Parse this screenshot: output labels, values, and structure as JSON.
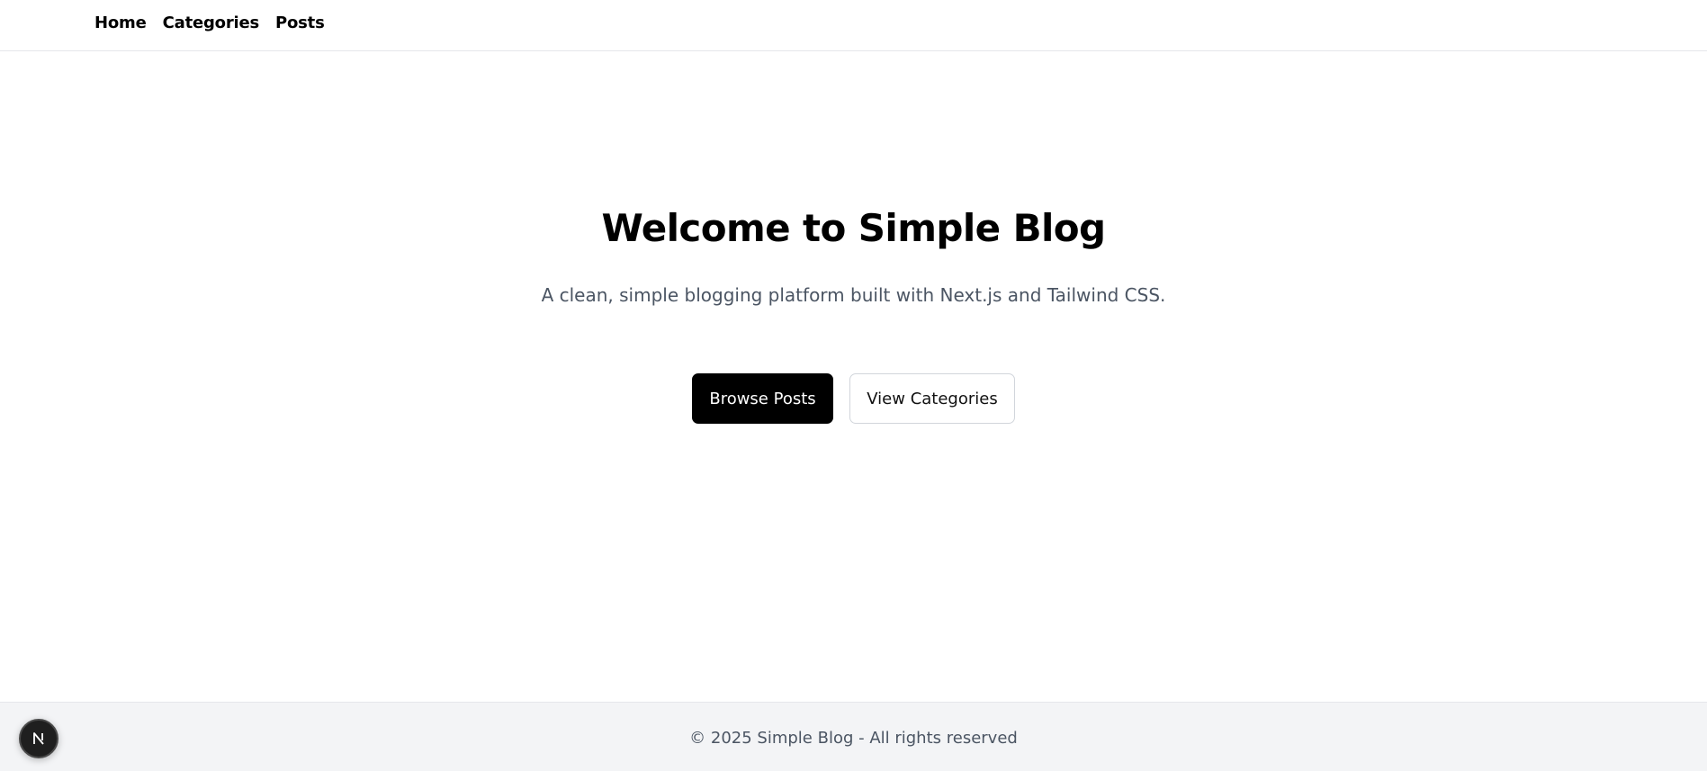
{
  "nav": {
    "links": [
      {
        "label": "Home"
      },
      {
        "label": "Categories"
      },
      {
        "label": "Posts"
      }
    ]
  },
  "hero": {
    "title": "Welcome to Simple Blog",
    "subtitle": "A clean, simple blogging platform built with Next.js and Tailwind CSS.",
    "primary_button": "Browse Posts",
    "secondary_button": "View Categories"
  },
  "footer": {
    "text": "© 2025 Simple Blog - All rights reserved"
  },
  "dev_badge": {
    "icon": "nextjs-logo-icon"
  },
  "colors": {
    "primary_button_bg": "#000000",
    "subtitle_text": "#4b5563",
    "footer_bg": "#f3f4f6"
  }
}
